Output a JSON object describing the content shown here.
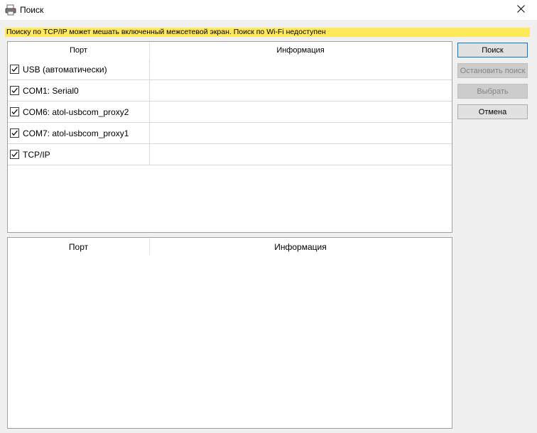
{
  "window": {
    "title": "Поиск",
    "app_icon": "printer-icon",
    "close_icon": "close-icon"
  },
  "warning": {
    "text": "Поиску по TCP/IP может мешать включенный межсетевой экран. Поиск по Wi-Fi недоступен",
    "background": "#fde95a"
  },
  "ports_table": {
    "columns": [
      "Порт",
      "Информация"
    ],
    "rows": [
      {
        "port": "USB (автоматически)",
        "info": "",
        "checked": true
      },
      {
        "port": "COM1: Serial0",
        "info": "",
        "checked": true
      },
      {
        "port": "COM6: atol-usbcom_proxy2",
        "info": "",
        "checked": true
      },
      {
        "port": "COM7: atol-usbcom_proxy1",
        "info": "",
        "checked": true
      },
      {
        "port": "TCP/IP",
        "info": "",
        "checked": true
      }
    ]
  },
  "results_table": {
    "columns": [
      "Порт",
      "Информация"
    ],
    "rows": []
  },
  "buttons": {
    "search": "Поиск",
    "stop_search": "Остановить поиск",
    "select": "Выбрать",
    "cancel": "Отмена"
  },
  "colors": {
    "accent": "#0078d7",
    "window_bg": "#f0f0f0",
    "disabled_text": "#838383"
  }
}
